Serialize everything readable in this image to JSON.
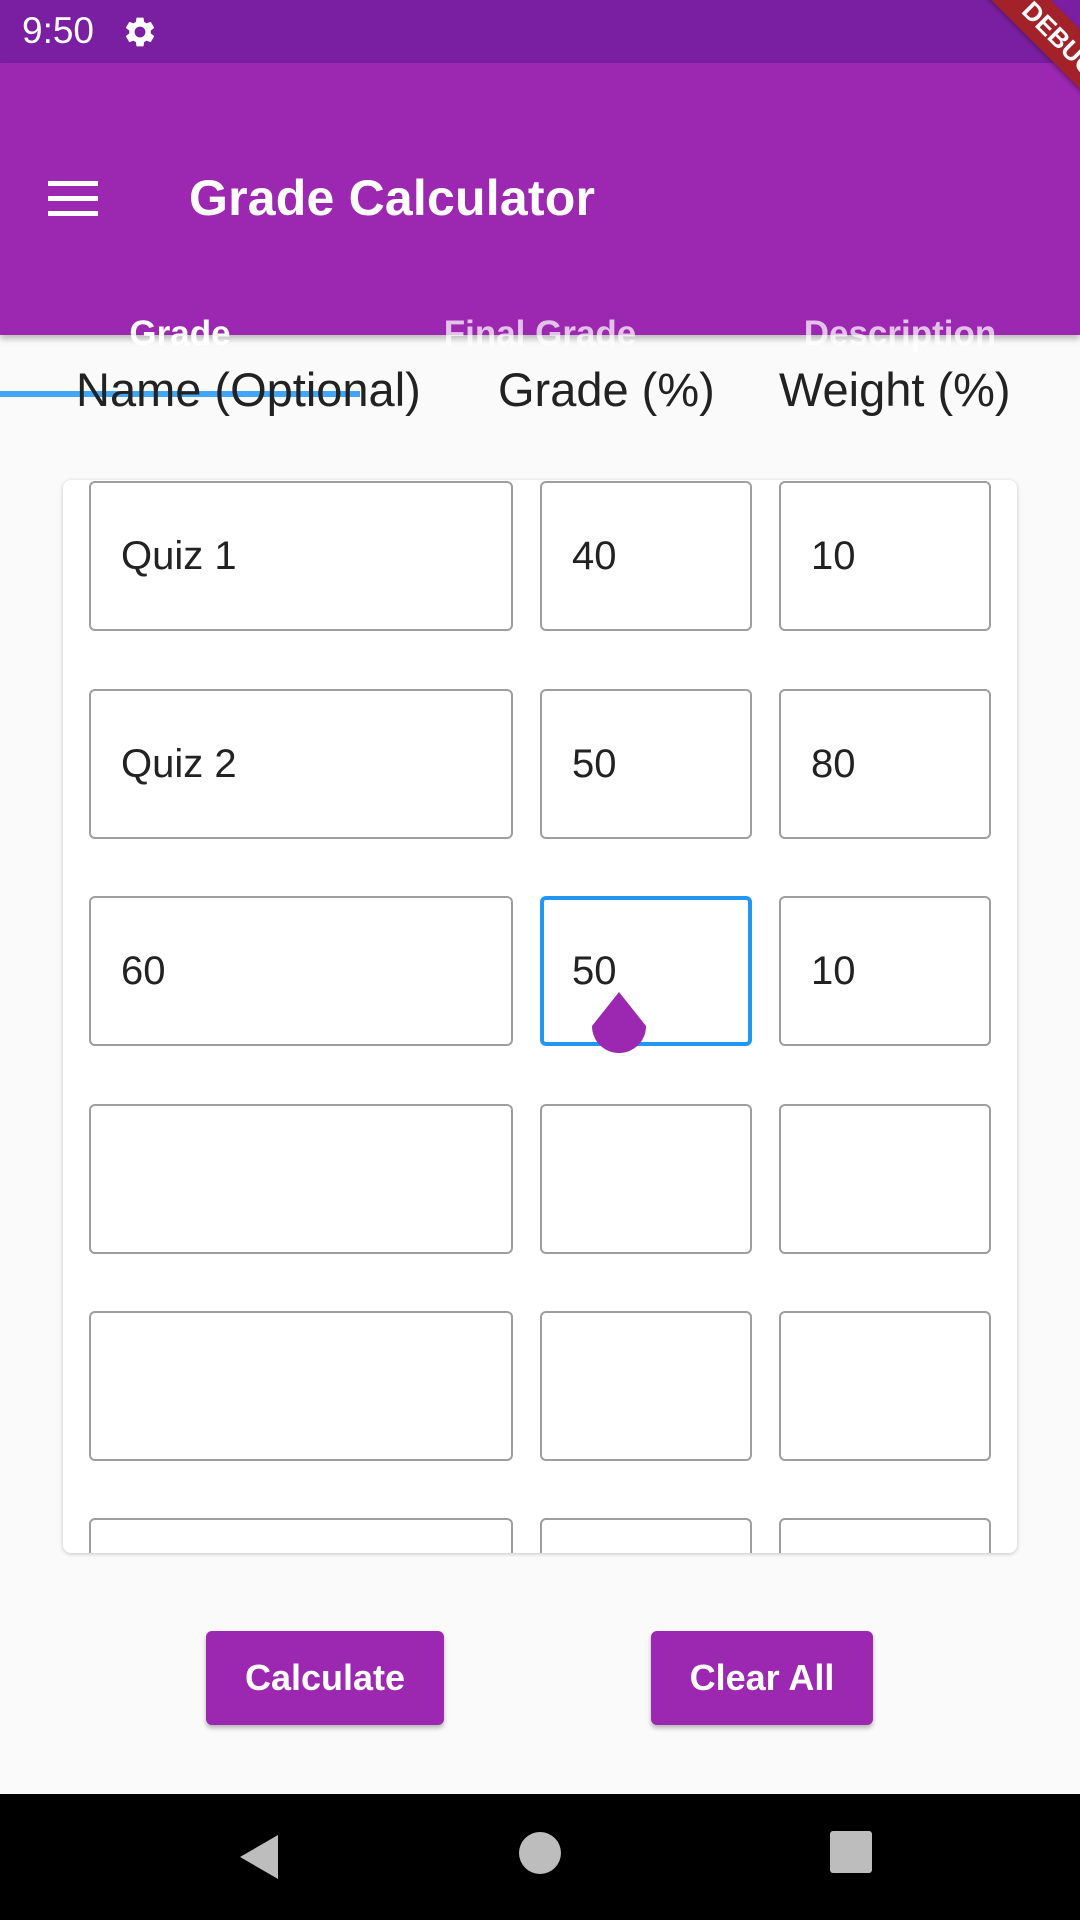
{
  "status_bar": {
    "time": "9:50",
    "icons": [
      "gear-icon",
      "battery-icon"
    ]
  },
  "debug_banner": "DEBUG",
  "app_bar": {
    "title": "Grade Calculator",
    "menu_icon": "menu-icon"
  },
  "tabs": [
    {
      "label": "Grade",
      "active": true
    },
    {
      "label": "Final Grade",
      "active": false
    },
    {
      "label": "Description",
      "active": false
    }
  ],
  "columns": {
    "name": "Name (Optional)",
    "grade": "Grade (%)",
    "weight": "Weight (%)"
  },
  "rows": [
    {
      "name": "Quiz 1",
      "grade": "40",
      "weight": "10"
    },
    {
      "name": "Quiz 2",
      "grade": "50",
      "weight": "80"
    },
    {
      "name": "60",
      "grade": "50",
      "weight": "10"
    },
    {
      "name": "",
      "grade": "",
      "weight": ""
    },
    {
      "name": "",
      "grade": "",
      "weight": ""
    },
    {
      "name": "",
      "grade": "",
      "weight": ""
    }
  ],
  "buttons": {
    "calculate": "Calculate",
    "clear_all": "Clear All"
  },
  "colors": {
    "primary": "#9c27b0",
    "status_bar": "#7b1fa2",
    "tab_indicator": "#42a5f5",
    "focus": "#2196f3"
  }
}
